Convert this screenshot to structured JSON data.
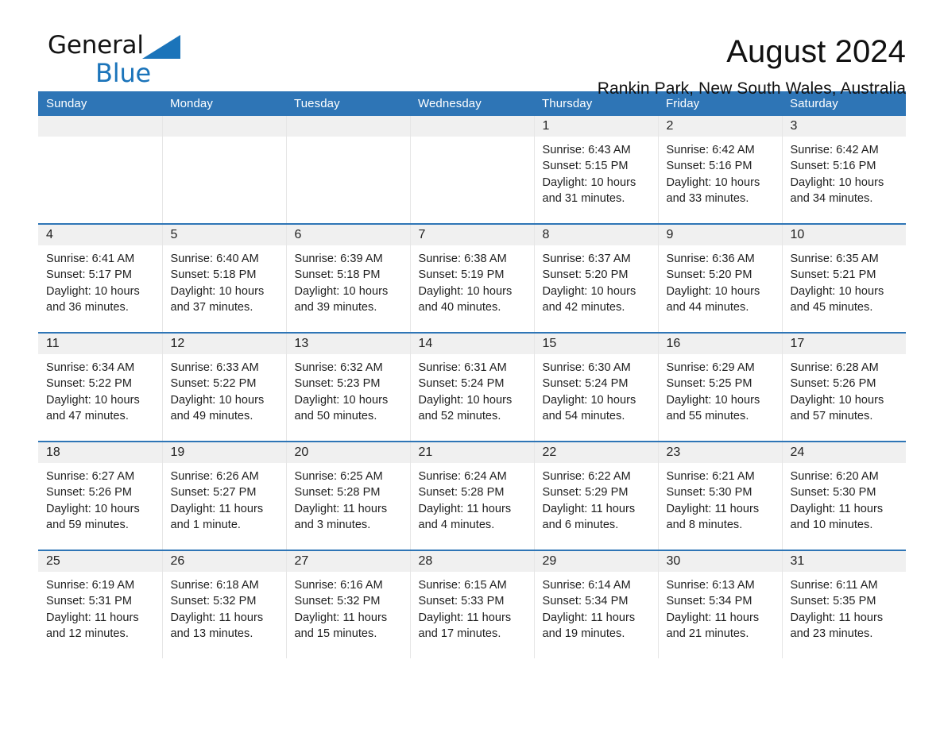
{
  "brand": {
    "name_part1": "General",
    "name_part2": "Blue",
    "logo_icon": "triangle-logo-icon",
    "accent_color": "#1b74ba"
  },
  "header": {
    "title": "August 2024",
    "subtitle": "Rankin Park, New South Wales, Australia"
  },
  "theme": {
    "header_row_color": "#2e75b6",
    "daynum_band_color": "#f0f0f0",
    "text_color": "#1e1e1e"
  },
  "calendar": {
    "weekday_headers": [
      "Sunday",
      "Monday",
      "Tuesday",
      "Wednesday",
      "Thursday",
      "Friday",
      "Saturday"
    ],
    "weeks": [
      [
        {
          "date": "",
          "empty": true
        },
        {
          "date": "",
          "empty": true
        },
        {
          "date": "",
          "empty": true
        },
        {
          "date": "",
          "empty": true
        },
        {
          "date": "1",
          "sunrise": "Sunrise: 6:43 AM",
          "sunset": "Sunset: 5:15 PM",
          "daylight_line1": "Daylight: 10 hours",
          "daylight_line2": "and 31 minutes."
        },
        {
          "date": "2",
          "sunrise": "Sunrise: 6:42 AM",
          "sunset": "Sunset: 5:16 PM",
          "daylight_line1": "Daylight: 10 hours",
          "daylight_line2": "and 33 minutes."
        },
        {
          "date": "3",
          "sunrise": "Sunrise: 6:42 AM",
          "sunset": "Sunset: 5:16 PM",
          "daylight_line1": "Daylight: 10 hours",
          "daylight_line2": "and 34 minutes."
        }
      ],
      [
        {
          "date": "4",
          "sunrise": "Sunrise: 6:41 AM",
          "sunset": "Sunset: 5:17 PM",
          "daylight_line1": "Daylight: 10 hours",
          "daylight_line2": "and 36 minutes."
        },
        {
          "date": "5",
          "sunrise": "Sunrise: 6:40 AM",
          "sunset": "Sunset: 5:18 PM",
          "daylight_line1": "Daylight: 10 hours",
          "daylight_line2": "and 37 minutes."
        },
        {
          "date": "6",
          "sunrise": "Sunrise: 6:39 AM",
          "sunset": "Sunset: 5:18 PM",
          "daylight_line1": "Daylight: 10 hours",
          "daylight_line2": "and 39 minutes."
        },
        {
          "date": "7",
          "sunrise": "Sunrise: 6:38 AM",
          "sunset": "Sunset: 5:19 PM",
          "daylight_line1": "Daylight: 10 hours",
          "daylight_line2": "and 40 minutes."
        },
        {
          "date": "8",
          "sunrise": "Sunrise: 6:37 AM",
          "sunset": "Sunset: 5:20 PM",
          "daylight_line1": "Daylight: 10 hours",
          "daylight_line2": "and 42 minutes."
        },
        {
          "date": "9",
          "sunrise": "Sunrise: 6:36 AM",
          "sunset": "Sunset: 5:20 PM",
          "daylight_line1": "Daylight: 10 hours",
          "daylight_line2": "and 44 minutes."
        },
        {
          "date": "10",
          "sunrise": "Sunrise: 6:35 AM",
          "sunset": "Sunset: 5:21 PM",
          "daylight_line1": "Daylight: 10 hours",
          "daylight_line2": "and 45 minutes."
        }
      ],
      [
        {
          "date": "11",
          "sunrise": "Sunrise: 6:34 AM",
          "sunset": "Sunset: 5:22 PM",
          "daylight_line1": "Daylight: 10 hours",
          "daylight_line2": "and 47 minutes."
        },
        {
          "date": "12",
          "sunrise": "Sunrise: 6:33 AM",
          "sunset": "Sunset: 5:22 PM",
          "daylight_line1": "Daylight: 10 hours",
          "daylight_line2": "and 49 minutes."
        },
        {
          "date": "13",
          "sunrise": "Sunrise: 6:32 AM",
          "sunset": "Sunset: 5:23 PM",
          "daylight_line1": "Daylight: 10 hours",
          "daylight_line2": "and 50 minutes."
        },
        {
          "date": "14",
          "sunrise": "Sunrise: 6:31 AM",
          "sunset": "Sunset: 5:24 PM",
          "daylight_line1": "Daylight: 10 hours",
          "daylight_line2": "and 52 minutes."
        },
        {
          "date": "15",
          "sunrise": "Sunrise: 6:30 AM",
          "sunset": "Sunset: 5:24 PM",
          "daylight_line1": "Daylight: 10 hours",
          "daylight_line2": "and 54 minutes."
        },
        {
          "date": "16",
          "sunrise": "Sunrise: 6:29 AM",
          "sunset": "Sunset: 5:25 PM",
          "daylight_line1": "Daylight: 10 hours",
          "daylight_line2": "and 55 minutes."
        },
        {
          "date": "17",
          "sunrise": "Sunrise: 6:28 AM",
          "sunset": "Sunset: 5:26 PM",
          "daylight_line1": "Daylight: 10 hours",
          "daylight_line2": "and 57 minutes."
        }
      ],
      [
        {
          "date": "18",
          "sunrise": "Sunrise: 6:27 AM",
          "sunset": "Sunset: 5:26 PM",
          "daylight_line1": "Daylight: 10 hours",
          "daylight_line2": "and 59 minutes."
        },
        {
          "date": "19",
          "sunrise": "Sunrise: 6:26 AM",
          "sunset": "Sunset: 5:27 PM",
          "daylight_line1": "Daylight: 11 hours",
          "daylight_line2": "and 1 minute."
        },
        {
          "date": "20",
          "sunrise": "Sunrise: 6:25 AM",
          "sunset": "Sunset: 5:28 PM",
          "daylight_line1": "Daylight: 11 hours",
          "daylight_line2": "and 3 minutes."
        },
        {
          "date": "21",
          "sunrise": "Sunrise: 6:24 AM",
          "sunset": "Sunset: 5:28 PM",
          "daylight_line1": "Daylight: 11 hours",
          "daylight_line2": "and 4 minutes."
        },
        {
          "date": "22",
          "sunrise": "Sunrise: 6:22 AM",
          "sunset": "Sunset: 5:29 PM",
          "daylight_line1": "Daylight: 11 hours",
          "daylight_line2": "and 6 minutes."
        },
        {
          "date": "23",
          "sunrise": "Sunrise: 6:21 AM",
          "sunset": "Sunset: 5:30 PM",
          "daylight_line1": "Daylight: 11 hours",
          "daylight_line2": "and 8 minutes."
        },
        {
          "date": "24",
          "sunrise": "Sunrise: 6:20 AM",
          "sunset": "Sunset: 5:30 PM",
          "daylight_line1": "Daylight: 11 hours",
          "daylight_line2": "and 10 minutes."
        }
      ],
      [
        {
          "date": "25",
          "sunrise": "Sunrise: 6:19 AM",
          "sunset": "Sunset: 5:31 PM",
          "daylight_line1": "Daylight: 11 hours",
          "daylight_line2": "and 12 minutes."
        },
        {
          "date": "26",
          "sunrise": "Sunrise: 6:18 AM",
          "sunset": "Sunset: 5:32 PM",
          "daylight_line1": "Daylight: 11 hours",
          "daylight_line2": "and 13 minutes."
        },
        {
          "date": "27",
          "sunrise": "Sunrise: 6:16 AM",
          "sunset": "Sunset: 5:32 PM",
          "daylight_line1": "Daylight: 11 hours",
          "daylight_line2": "and 15 minutes."
        },
        {
          "date": "28",
          "sunrise": "Sunrise: 6:15 AM",
          "sunset": "Sunset: 5:33 PM",
          "daylight_line1": "Daylight: 11 hours",
          "daylight_line2": "and 17 minutes."
        },
        {
          "date": "29",
          "sunrise": "Sunrise: 6:14 AM",
          "sunset": "Sunset: 5:34 PM",
          "daylight_line1": "Daylight: 11 hours",
          "daylight_line2": "and 19 minutes."
        },
        {
          "date": "30",
          "sunrise": "Sunrise: 6:13 AM",
          "sunset": "Sunset: 5:34 PM",
          "daylight_line1": "Daylight: 11 hours",
          "daylight_line2": "and 21 minutes."
        },
        {
          "date": "31",
          "sunrise": "Sunrise: 6:11 AM",
          "sunset": "Sunset: 5:35 PM",
          "daylight_line1": "Daylight: 11 hours",
          "daylight_line2": "and 23 minutes."
        }
      ]
    ]
  }
}
